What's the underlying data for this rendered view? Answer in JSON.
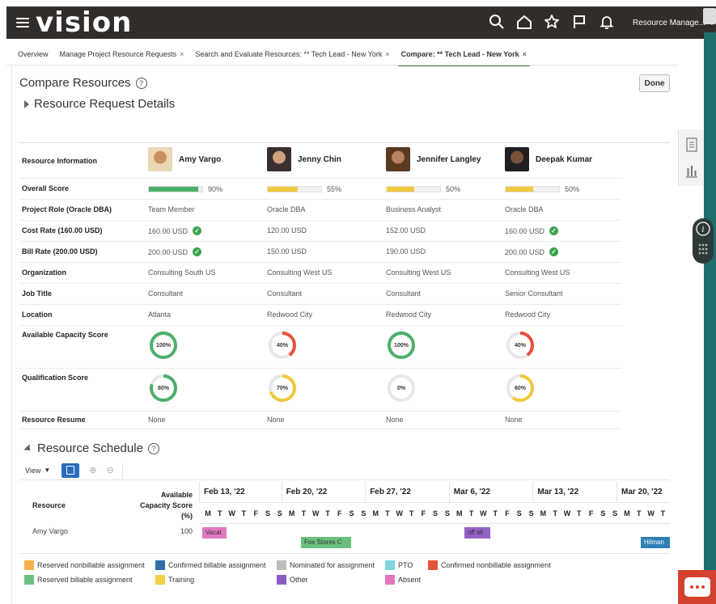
{
  "header": {
    "app_name": "vision",
    "user_menu_label": "Resource Manage...",
    "icons": [
      "search-icon",
      "home-icon",
      "star-icon",
      "flag-icon",
      "bell-icon"
    ]
  },
  "tabs": [
    {
      "label": "Overview",
      "closable": false,
      "active": false
    },
    {
      "label": "Manage Project Resource Requests",
      "closable": true,
      "active": false
    },
    {
      "label": "Search and Evaluate Resources: ** Tech Lead - New York",
      "closable": true,
      "active": false
    },
    {
      "label": "Compare: ** Tech Lead - New York",
      "closable": true,
      "active": true
    }
  ],
  "tab_close_glyph": "×",
  "page": {
    "title": "Compare Resources",
    "done_label": "Done",
    "details_section": "Resource Request Details"
  },
  "compare": {
    "row_labels": {
      "resource_information": "Resource Information",
      "overall_score": "Overall Score",
      "project_role": "Project Role (Oracle DBA)",
      "cost_rate": "Cost Rate (160.00 USD)",
      "bill_rate": "Bill Rate (200.00 USD)",
      "organization": "Organization",
      "job_title": "Job Title",
      "location": "Location",
      "available_capacity": "Available Capacity Score",
      "qualification": "Qualification Score",
      "resume": "Resource Resume"
    },
    "resources": [
      {
        "name": "Amy Vargo",
        "overall": "90%",
        "overall_value": 0.9,
        "overall_color": "#4caf6a",
        "role": "Team Member",
        "cost": "160.00 USD",
        "cost_match": true,
        "bill": "200.00 USD",
        "bill_match": true,
        "organization": "Consulting South US",
        "job_title": "Consultant",
        "location": "Atlanta",
        "capacity": "100%",
        "capacity_value": 1.0,
        "capacity_color": "#4caf6a",
        "qualification": "80%",
        "qualification_value": 0.8,
        "qualification_color": "#4caf6a",
        "resume": "None"
      },
      {
        "name": "Jenny Chin",
        "overall": "55%",
        "overall_value": 0.55,
        "overall_color": "#f0c93e",
        "role": "Oracle DBA",
        "cost": "120.00 USD",
        "cost_match": true,
        "bill": "150.00 USD",
        "bill_match": true,
        "organization": "Consulting West US",
        "job_title": "Consultant",
        "location": "Redwood City",
        "capacity": "40%",
        "capacity_value": 0.4,
        "capacity_color": "#e5533d",
        "qualification": "70%",
        "qualification_value": 0.7,
        "qualification_color": "#f0c93e",
        "resume": "None"
      },
      {
        "name": "Jennifer Langley",
        "overall": "50%",
        "overall_value": 0.5,
        "overall_color": "#f0c93e",
        "role": "Business Analyst",
        "cost": "152.00 USD",
        "cost_match": false,
        "bill": "190.00 USD",
        "bill_match": false,
        "organization": "Consulting West US",
        "job_title": "Consultant",
        "location": "Redwood City",
        "capacity": "100%",
        "capacity_value": 1.0,
        "capacity_color": "#4caf6a",
        "qualification": "0%",
        "qualification_value": 0.0,
        "qualification_color": "#e6e6e6",
        "resume": "None"
      },
      {
        "name": "Deepak Kumar",
        "overall": "50%",
        "overall_value": 0.5,
        "overall_color": "#f0c93e",
        "role": "Oracle DBA",
        "cost": "160.00 USD",
        "cost_match": true,
        "bill": "200.00 USD",
        "bill_match": true,
        "organization": "Consulting West US",
        "job_title": "Senior Consultant",
        "location": "Redwood City",
        "capacity": "40%",
        "capacity_value": 0.4,
        "capacity_color": "#e5533d",
        "qualification": "60%",
        "qualification_value": 0.6,
        "qualification_color": "#f0c93e",
        "resume": "None"
      }
    ]
  },
  "schedule": {
    "title": "Resource Schedule",
    "view_label": "View",
    "col_resource": "Resource",
    "col_capacity": [
      "Available",
      "Capacity Score",
      "(%)"
    ],
    "weeks": [
      "Feb 13, '22",
      "Feb 20, '22",
      "Feb 27, '22",
      "Mar 6, '22",
      "Mar 13, '22",
      "Mar 20, '22"
    ],
    "day_letters": [
      "S",
      "M",
      "T",
      "W",
      "T",
      "F",
      "S"
    ],
    "rows": [
      {
        "resource": "Amy Vargo",
        "capacity": "100",
        "bars": [
          {
            "label": "Vacat",
            "color": "#e277c0"
          },
          {
            "label": "Fox Stores C",
            "color": "#6cc07f"
          },
          {
            "label": "off sit",
            "color": "#9462c7"
          },
          {
            "label": "Hilman",
            "color": "#2f7fb5"
          }
        ]
      }
    ]
  },
  "legend": [
    {
      "label": "Reserved nonbillable assignment",
      "color": "#f6b24a"
    },
    {
      "label": "Confirmed billable assignment",
      "color": "#2f6fa6"
    },
    {
      "label": "Nominated for assignment",
      "color": "#bdbdbd"
    },
    {
      "label": "PTO",
      "color": "#7fd6e0"
    },
    {
      "label": "Confirmed nonbillable assignment",
      "color": "#e2553a"
    },
    {
      "label": "Reserved billable assignment",
      "color": "#6cc07f"
    },
    {
      "label": "Training",
      "color": "#f1d04a"
    },
    {
      "label": "Other",
      "color": "#8e5bc6"
    },
    {
      "label": "Absent",
      "color": "#e277c0"
    }
  ],
  "colors": {
    "header_bg": "#312d2a",
    "accent_green": "#3f7a4f",
    "chat_red": "#d4412f"
  }
}
